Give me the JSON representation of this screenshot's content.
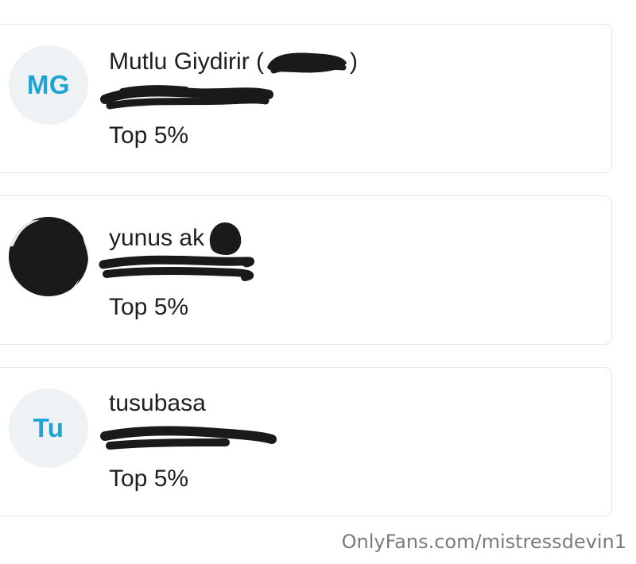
{
  "cards": [
    {
      "initials": "MG",
      "name": "Mutlu Giydirir (",
      "name_suffix": ")",
      "badge": "Top 5%"
    },
    {
      "initials": "",
      "name": "yunus ak",
      "badge": "Top 5%"
    },
    {
      "initials": "Tu",
      "name": "tusubasa",
      "badge": "Top 5%"
    }
  ],
  "colors": {
    "initials_text": "#1ea4d4",
    "avatar_bg": "#eef2f4",
    "card_border": "#e3e6e8",
    "redaction": "#1a1a1a"
  },
  "watermark": "OnlyFans.com/mistressdevin1"
}
